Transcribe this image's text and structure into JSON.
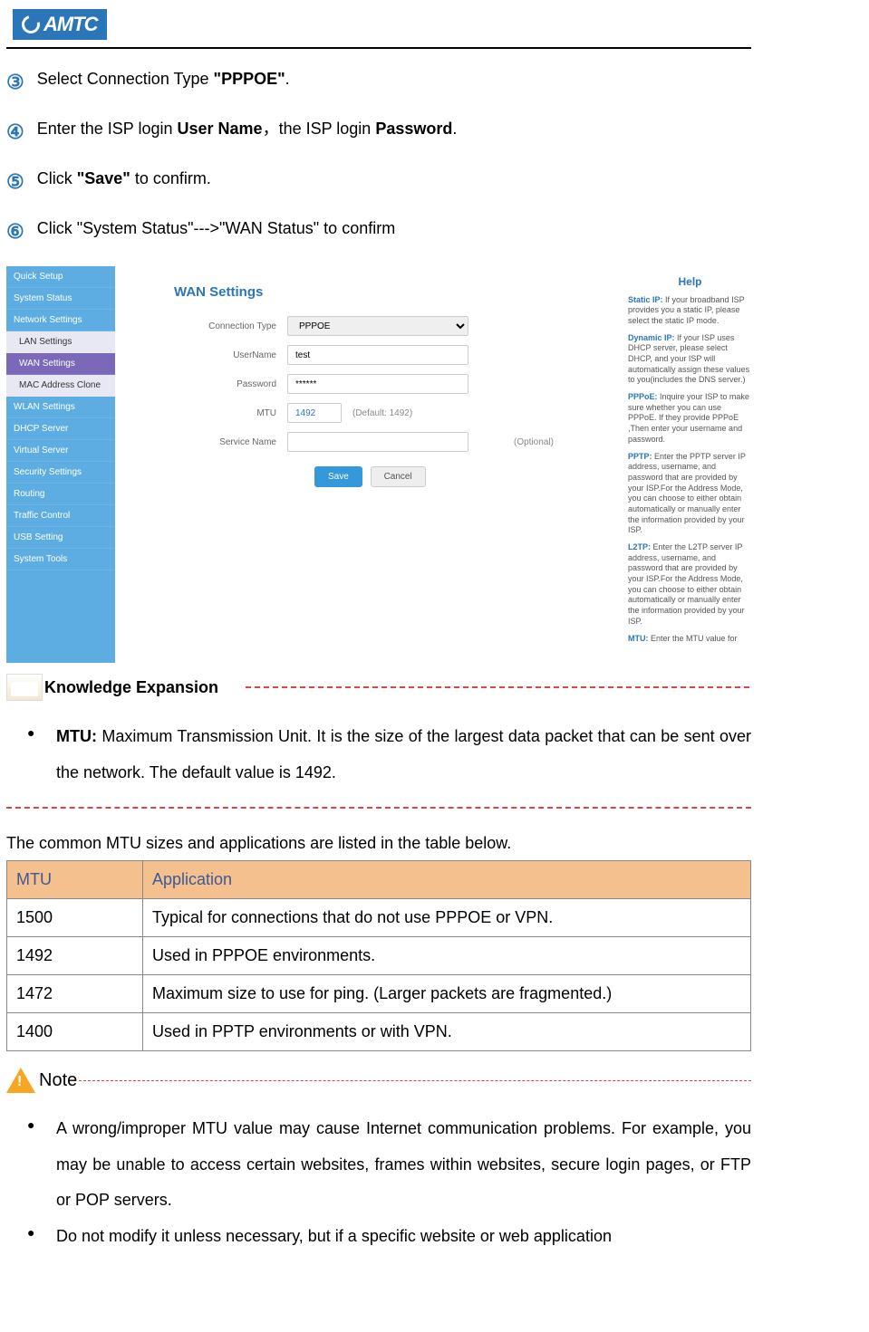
{
  "logo": "AMTC",
  "steps": [
    {
      "num": "③",
      "pre": "Select Connection Type ",
      "bold": "\"PPPOE\"",
      "post": "."
    },
    {
      "num": "④",
      "pre": "Enter the ISP login ",
      "bold": "User Name",
      "mid": "，the ISP login ",
      "bold2": "Password",
      "post": "."
    },
    {
      "num": "⑤",
      "pre": "Click ",
      "bold": "\"Save\"",
      "post": " to confirm."
    },
    {
      "num": "⑥",
      "pre": "Click \"System Status\"--->\"WAN Status\" to confirm",
      "bold": "",
      "post": ""
    }
  ],
  "screenshot": {
    "sidebar": [
      "Quick Setup",
      "System Status",
      "Network Settings",
      "LAN Settings",
      "WAN Settings",
      "MAC Address Clone",
      "WLAN Settings",
      "DHCP Server",
      "Virtual Server",
      "Security Settings",
      "Routing",
      "Traffic Control",
      "USB Setting",
      "System Tools"
    ],
    "title": "WAN Settings",
    "fields": {
      "conn_label": "Connection Type",
      "conn_value": "PPPOE",
      "user_label": "UserName",
      "user_value": "test",
      "pass_label": "Password",
      "pass_value": "******",
      "mtu_label": "MTU",
      "mtu_value": "1492",
      "mtu_default": "(Default: 1492)",
      "svc_label": "Service Name",
      "svc_value": "",
      "svc_opt": "(Optional)"
    },
    "buttons": {
      "save": "Save",
      "cancel": "Cancel"
    },
    "help": {
      "title": "Help",
      "static_h": "Static IP:",
      "static_t": " If your broadband ISP provides you a static IP, please select the static IP mode.",
      "dyn_h": "Dynamic IP:",
      "dyn_t": " If your ISP uses DHCP server, please select DHCP, and your ISP will automatically assign these values to you(includes the DNS server.)",
      "ppp_h": "PPPoE:",
      "ppp_t": " Inquire your ISP to make sure whether you can use PPPoE. If they provide PPPoE ,Then enter your username and password.",
      "pptp_h": "PPTP:",
      "pptp_t": " Enter the PPTP server IP address, username, and password that are provided by your ISP.For the Address Mode, you can choose to either obtain automatically or manually enter the information provided by your ISP.",
      "l2tp_h": "L2TP:",
      "l2tp_t": " Enter the L2TP server IP address, username, and password that are provided by your ISP.For the Address Mode, you can choose to either obtain automatically or manually enter the information provided by your ISP.",
      "mtu_h": "MTU:",
      "mtu_t": " Enter the MTU value for"
    }
  },
  "knowledge_title": "Knowledge Expansion",
  "mtu_bullet_bold": "MTU: ",
  "mtu_bullet": "Maximum Transmission Unit. It is the size of the largest data packet that can be sent over the network. The default value is 1492.",
  "table_intro": "The common MTU sizes and applications are listed in the table below.",
  "table": {
    "h1": "MTU",
    "h2": "Application",
    "rows": [
      {
        "mtu": "1500",
        "app": "Typical for connections that do not use PPPOE or VPN."
      },
      {
        "mtu": "1492",
        "app": "Used in PPPOE environments."
      },
      {
        "mtu": "1472",
        "app": "Maximum size to use for ping. (Larger packets are fragmented.)"
      },
      {
        "mtu": "1400",
        "app": "Used in PPTP environments or with VPN."
      }
    ]
  },
  "note_label": "Note",
  "note_bullets": [
    "A wrong/improper MTU value may cause Internet communication problems. For example, you may be unable to access certain websites, frames within websites, secure login pages, or FTP or POP servers.",
    "Do not modify it unless necessary, but if a specific website or web application"
  ]
}
